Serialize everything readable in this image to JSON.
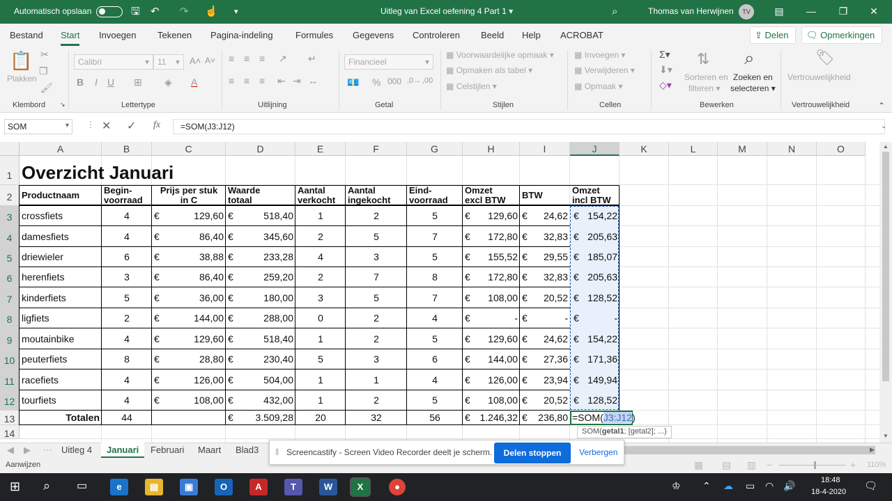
{
  "titlebar": {
    "autosave_label": "Automatisch opslaan",
    "doc_title": "Uitleg van Excel oefening 4 Part 1",
    "user_name": "Thomas van Herwijnen",
    "user_initials": "TV"
  },
  "menu": {
    "tabs": [
      "Bestand",
      "Start",
      "Invoegen",
      "Tekenen",
      "Pagina-indeling",
      "Formules",
      "Gegevens",
      "Controleren",
      "Beeld",
      "Help",
      "ACROBAT"
    ],
    "share_label": "Delen",
    "comments_label": "Opmerkingen"
  },
  "ribbon": {
    "paste_label": "Plakken",
    "font_name": "Calibri",
    "font_size": "11",
    "number_format": "Financieel",
    "conditional_label": "Voorwaardelijke opmaak",
    "table_label": "Opmaken als tabel",
    "cellstyles_label": "Celstijlen",
    "insert_label": "Invoegen",
    "delete_label": "Verwijderen",
    "format_label": "Opmaak",
    "sort_label1": "Sorteren en",
    "sort_label2": "filteren",
    "find_label1": "Zoeken en",
    "find_label2": "selecteren",
    "sensitivity_label": "Vertrouwelijkheid",
    "groups": {
      "clipboard": "Klembord",
      "font": "Lettertype",
      "alignment": "Uitlijning",
      "number": "Getal",
      "styles": "Stijlen",
      "cells": "Cellen",
      "edit": "Bewerken",
      "sensitivity": "Vertrouwelijkheid"
    }
  },
  "formulabar": {
    "name_box": "SOM",
    "fx": "fx",
    "formula": "=SOM(J3:J12)"
  },
  "grid": {
    "columns": [
      "A",
      "B",
      "C",
      "D",
      "E",
      "F",
      "G",
      "H",
      "I",
      "J",
      "K",
      "L",
      "M",
      "N",
      "O"
    ],
    "rows": [
      "1",
      "2",
      "3",
      "4",
      "5",
      "6",
      "7",
      "8",
      "9",
      "10",
      "11",
      "12",
      "13",
      "14"
    ],
    "title": "Overzicht Januari",
    "headers": {
      "a": "Productnaam",
      "b1": "Begin-",
      "b2": "voorraad",
      "c1": "Prijs per stuk",
      "c2": "in C",
      "d1": "Waarde",
      "d2": "totaal",
      "e1": "Aantal",
      "e2": "verkocht",
      "f1": "Aantal",
      "f2": "ingekocht",
      "g1": "Eind-",
      "g2": "voorraad",
      "h1": "Omzet",
      "h2": "excl BTW",
      "i1": "BTW",
      "j1": "Omzet",
      "j2": "incl BTW"
    },
    "data": [
      [
        "crossfiets",
        "4",
        "129,60",
        "518,40",
        "1",
        "2",
        "5",
        "129,60",
        "24,62",
        "154,22"
      ],
      [
        "damesfiets",
        "4",
        "86,40",
        "345,60",
        "2",
        "5",
        "7",
        "172,80",
        "32,83",
        "205,63"
      ],
      [
        "driewieler",
        "6",
        "38,88",
        "233,28",
        "4",
        "3",
        "5",
        "155,52",
        "29,55",
        "185,07"
      ],
      [
        "herenfiets",
        "3",
        "86,40",
        "259,20",
        "2",
        "7",
        "8",
        "172,80",
        "32,83",
        "205,63"
      ],
      [
        "kinderfiets",
        "5",
        "36,00",
        "180,00",
        "3",
        "5",
        "7",
        "108,00",
        "20,52",
        "128,52"
      ],
      [
        "ligfiets",
        "2",
        "144,00",
        "288,00",
        "0",
        "2",
        "4",
        "-",
        "-",
        "-"
      ],
      [
        "moutainbike",
        "4",
        "129,60",
        "518,40",
        "1",
        "2",
        "5",
        "129,60",
        "24,62",
        "154,22"
      ],
      [
        "peuterfiets",
        "8",
        "28,80",
        "230,40",
        "5",
        "3",
        "6",
        "144,00",
        "27,36",
        "171,36"
      ],
      [
        "racefiets",
        "4",
        "126,00",
        "504,00",
        "1",
        "1",
        "4",
        "126,00",
        "23,94",
        "149,94"
      ],
      [
        "tourfiets",
        "4",
        "108,00",
        "432,00",
        "1",
        "2",
        "5",
        "108,00",
        "20,52",
        "128,52"
      ]
    ],
    "currency": "€",
    "totals": {
      "label": "Totalen",
      "b": "44",
      "d": "3.509,28",
      "e": "20",
      "f": "32",
      "g": "56",
      "h": "1.246,32",
      "i": "236,80",
      "j_prefix": "=SOM(",
      "j_ref": "J3:J12",
      "j_suffix": ")"
    },
    "tooltip": {
      "fn": "SOM(",
      "arg1": "getal1",
      "rest": "; [getal2]; ...)"
    }
  },
  "sheets": {
    "tabs": [
      "Uitleg 4",
      "Januari",
      "Februari",
      "Maart",
      "Blad3"
    ],
    "active": "Januari"
  },
  "screencast": {
    "message": "Screencastify - Screen Video Recorder deelt je scherm.",
    "stop_label": "Delen stoppen",
    "hide_label": "Verbergen"
  },
  "status": {
    "mode": "Aanwijzen",
    "zoom": "110%"
  },
  "taskbar": {
    "time": "18:48",
    "date": "18-4-2020"
  },
  "colors": {
    "excel_green": "#217346",
    "selection_blue": "#e8f0fb",
    "button_blue": "#0f6cdb"
  }
}
